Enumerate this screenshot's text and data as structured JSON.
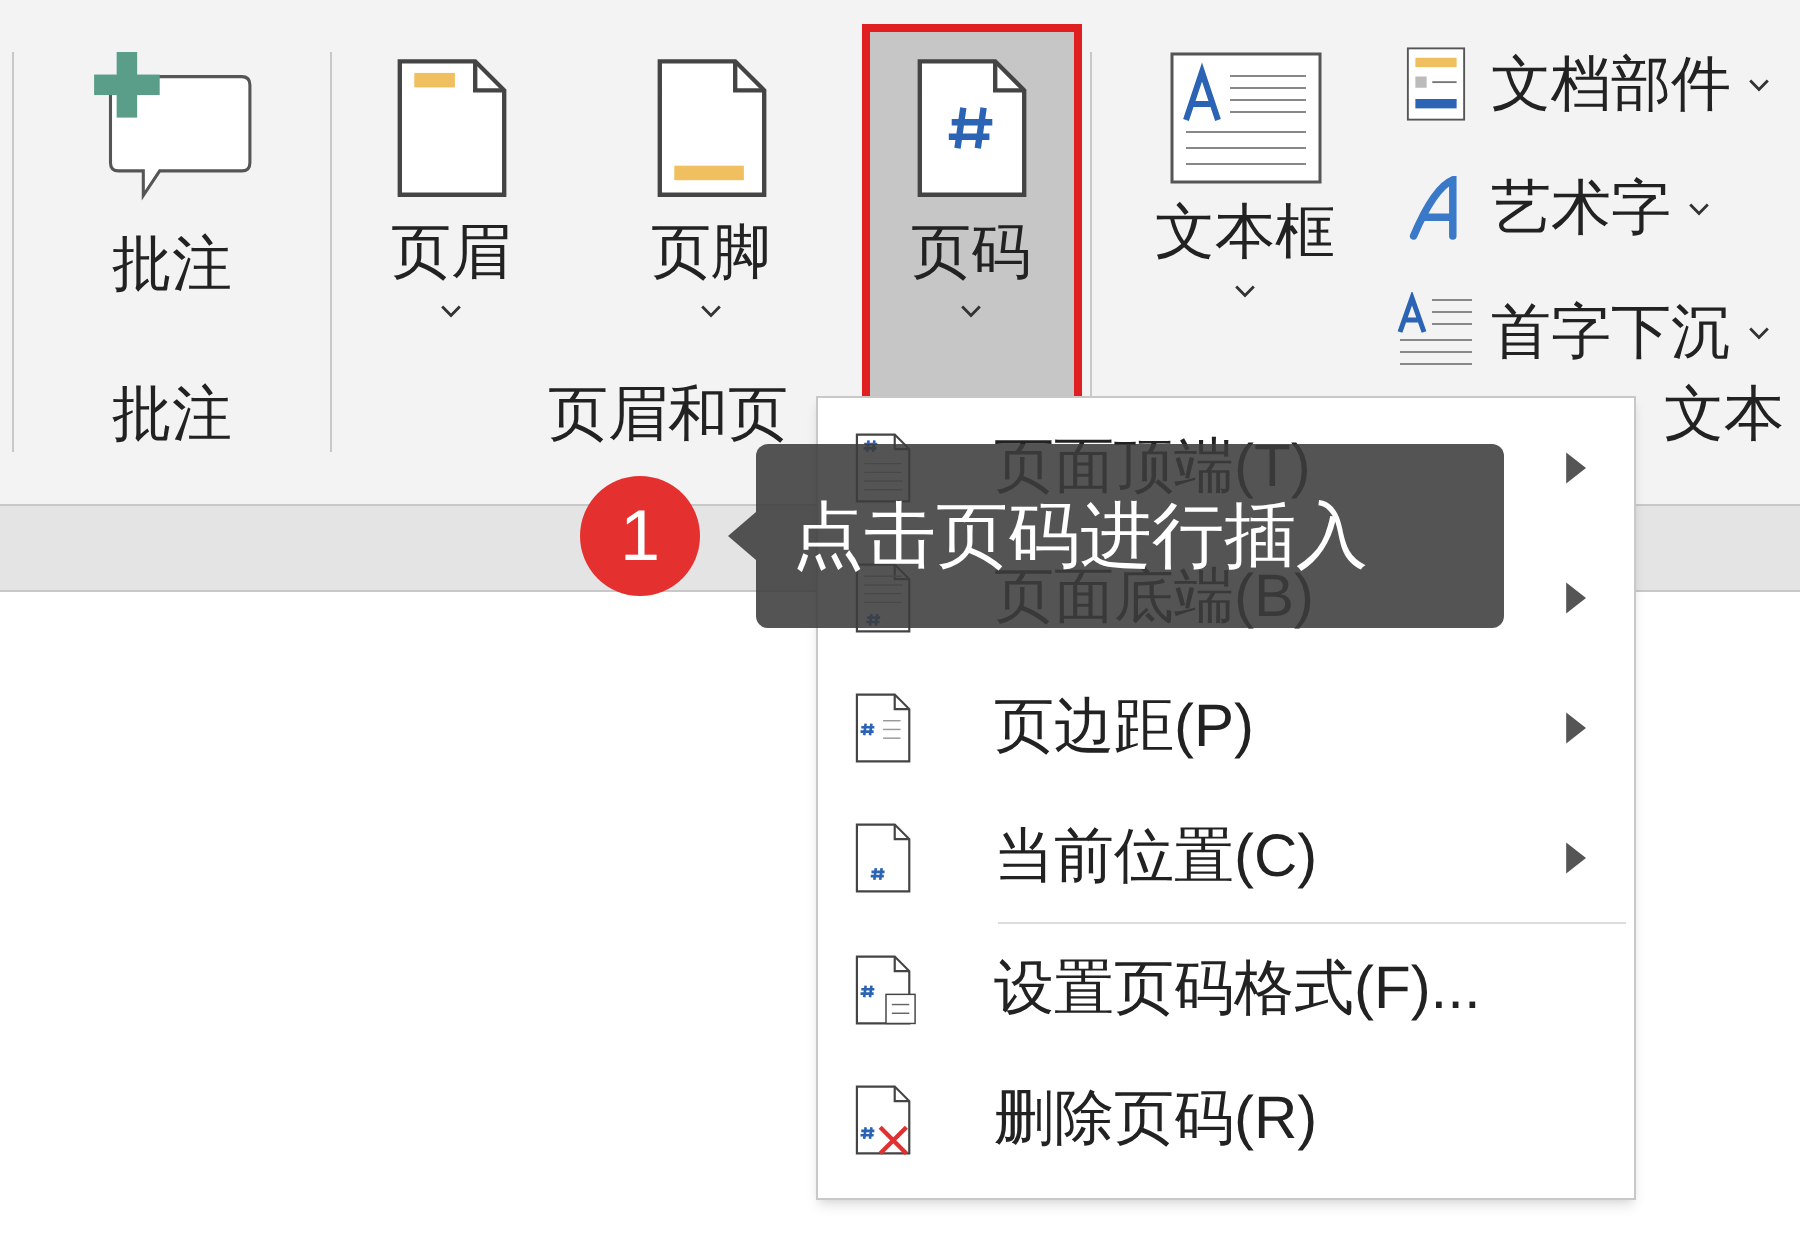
{
  "ribbon": {
    "groups": [
      {
        "label": "批注",
        "buttons": [
          {
            "label": "批注",
            "dropdown": false,
            "selected": false
          }
        ]
      },
      {
        "label": "页眉和页",
        "buttons": [
          {
            "label": "页眉",
            "dropdown": true,
            "selected": false
          },
          {
            "label": "页脚",
            "dropdown": true,
            "selected": false
          },
          {
            "label": "页码",
            "dropdown": true,
            "selected": true
          }
        ]
      },
      {
        "label": "文本",
        "buttons": [
          {
            "label": "文本框",
            "dropdown": true,
            "selected": false
          }
        ],
        "small_buttons": [
          {
            "label": "文档部件",
            "dropdown": true
          },
          {
            "label": "艺术字",
            "dropdown": true
          },
          {
            "label": "首字下沉",
            "dropdown": true
          }
        ]
      }
    ]
  },
  "menu": {
    "items": [
      {
        "label": "页面顶端(T)",
        "submenu": true,
        "separator_before": false
      },
      {
        "label": "页面底端(B)",
        "submenu": true,
        "separator_before": false
      },
      {
        "label": "页边距(P)",
        "submenu": true,
        "separator_before": false
      },
      {
        "label": "当前位置(C)",
        "submenu": true,
        "separator_before": false
      },
      {
        "label": "设置页码格式(F)...",
        "submenu": false,
        "separator_before": true
      },
      {
        "label": "删除页码(R)",
        "submenu": false,
        "separator_before": false
      }
    ]
  },
  "callout": {
    "step": "1",
    "text": "点击页码进行插入"
  }
}
